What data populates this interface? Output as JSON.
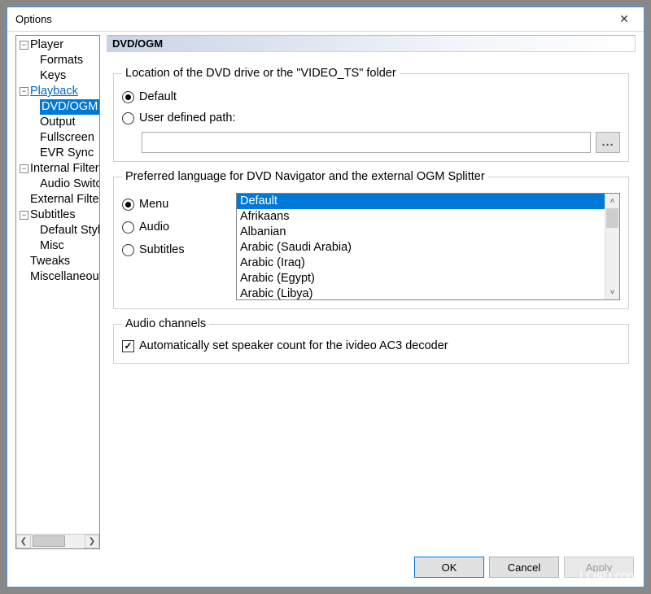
{
  "window": {
    "title": "Options",
    "close_glyph": "✕"
  },
  "tree": {
    "player": "Player",
    "formats": "Formats",
    "keys": "Keys",
    "playback": "Playback",
    "dvd_ogm": "DVD/OGM",
    "output": "Output",
    "fullscreen": "Fullscreen",
    "evr_sync": "EVR Sync",
    "internal_filters": "Internal Filters",
    "audio_switcher": "Audio Switcher",
    "external_filters": "External Filters",
    "subtitles": "Subtitles",
    "default_style": "Default Style",
    "misc": "Misc",
    "tweaks": "Tweaks",
    "miscellaneous": "Miscellaneous"
  },
  "panel": {
    "header": "DVD/OGM",
    "location_legend": "Location of the DVD drive or the \"VIDEO_TS\" folder",
    "default_label": "Default",
    "user_defined_label": "User defined path:",
    "path_value": "",
    "browse_label": "...",
    "lang_legend": "Preferred language for DVD Navigator and the external OGM Splitter",
    "lang_menu": "Menu",
    "lang_audio": "Audio",
    "lang_subtitles": "Subtitles",
    "lang_items": {
      "0": "Default",
      "1": "Afrikaans",
      "2": "Albanian",
      "3": "Arabic (Saudi Arabia)",
      "4": "Arabic (Iraq)",
      "5": "Arabic (Egypt)",
      "6": "Arabic (Libya)"
    },
    "audio_legend": "Audio channels",
    "audio_check_label": "Automatically set speaker count for the ivideo AC3 decoder"
  },
  "buttons": {
    "ok": "OK",
    "cancel": "Cancel",
    "apply": "Apply"
  },
  "watermark": "LO4D.com"
}
